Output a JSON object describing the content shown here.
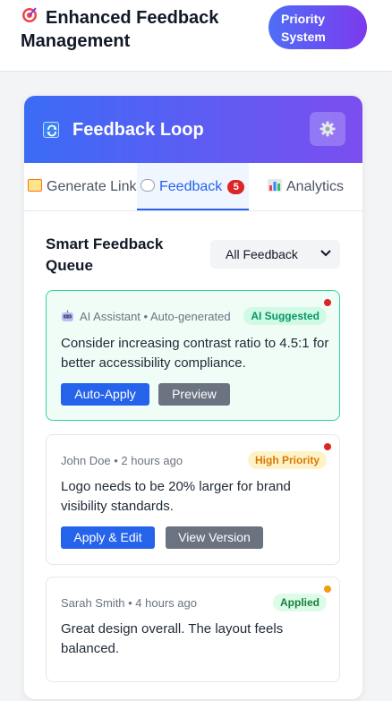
{
  "header": {
    "title": "Enhanced Feedback Management",
    "logo_icon": "target-icon",
    "priority_badge": "Priority System"
  },
  "panel": {
    "title": "Feedback Loop",
    "title_icon": "refresh-icon",
    "settings_icon": "gear-icon"
  },
  "tabs": [
    {
      "label": "Generate Link",
      "icon": "memo-icon",
      "active": false
    },
    {
      "label": "Feedback",
      "icon": "speech-bubble-icon",
      "active": true,
      "badge": "5"
    },
    {
      "label": "Analytics",
      "icon": "bar-chart-icon",
      "active": false
    }
  ],
  "queue": {
    "title": "Smart Feedback Queue",
    "filter": {
      "selected": "All Feedback"
    }
  },
  "feedback": [
    {
      "meta": "AI Assistant • Auto-generated",
      "status": "AI Suggested",
      "message": "Consider increasing contrast ratio to 4.5:1 for better accessibility compliance.",
      "actions": [
        "Auto-Apply",
        "Preview"
      ],
      "dot_color": "#dc2626"
    },
    {
      "meta": "John Doe • 2 hours ago",
      "status": "High Priority",
      "message": "Logo needs to be 20% larger for brand visibility standards.",
      "actions": [
        "Apply & Edit",
        "View Version"
      ],
      "dot_color": "#dc2626"
    },
    {
      "meta": "Sarah Smith • 4 hours ago",
      "status": "Applied",
      "message": "Great design overall. The layout feels balanced.",
      "actions": [],
      "dot_color": "#f59e0b"
    }
  ],
  "colors": {
    "accent": "#2563eb",
    "header_gradient_start": "#3b6cf6",
    "header_gradient_end": "#7c4ef0",
    "ai_border": "#34d399"
  }
}
